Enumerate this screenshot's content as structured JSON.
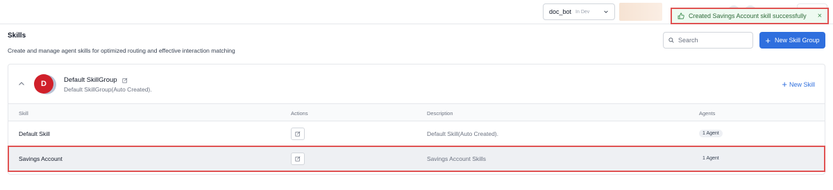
{
  "topbar": {
    "bot_name": "doc_bot",
    "bot_env": "In Dev"
  },
  "toast": {
    "message": "Created Savings Account skill successfully",
    "close": "×",
    "color": "#2f6b3a"
  },
  "header": {
    "title": "Skills",
    "subtitle": "Create and manage agent skills for optimized routing and effective interaction matching",
    "search_placeholder": "Search",
    "new_group_label": "New Skill Group"
  },
  "group": {
    "avatar_letter": "D",
    "name": "Default SkillGroup",
    "description": "Default SkillGroup(Auto Created).",
    "new_skill_label": "New Skill"
  },
  "table": {
    "columns": [
      "Skill",
      "Actions",
      "Description",
      "Agents"
    ],
    "rows": [
      {
        "skill": "Default Skill",
        "description": "Default Skill(Auto Created).",
        "agents": "1 Agent"
      },
      {
        "skill": "Savings Account",
        "description": "Savings Account Skills",
        "agents": "1 Agent"
      }
    ]
  },
  "colors": {
    "primary": "#2f6fde",
    "avatar": "#d0202a",
    "highlight": "#e05252"
  }
}
